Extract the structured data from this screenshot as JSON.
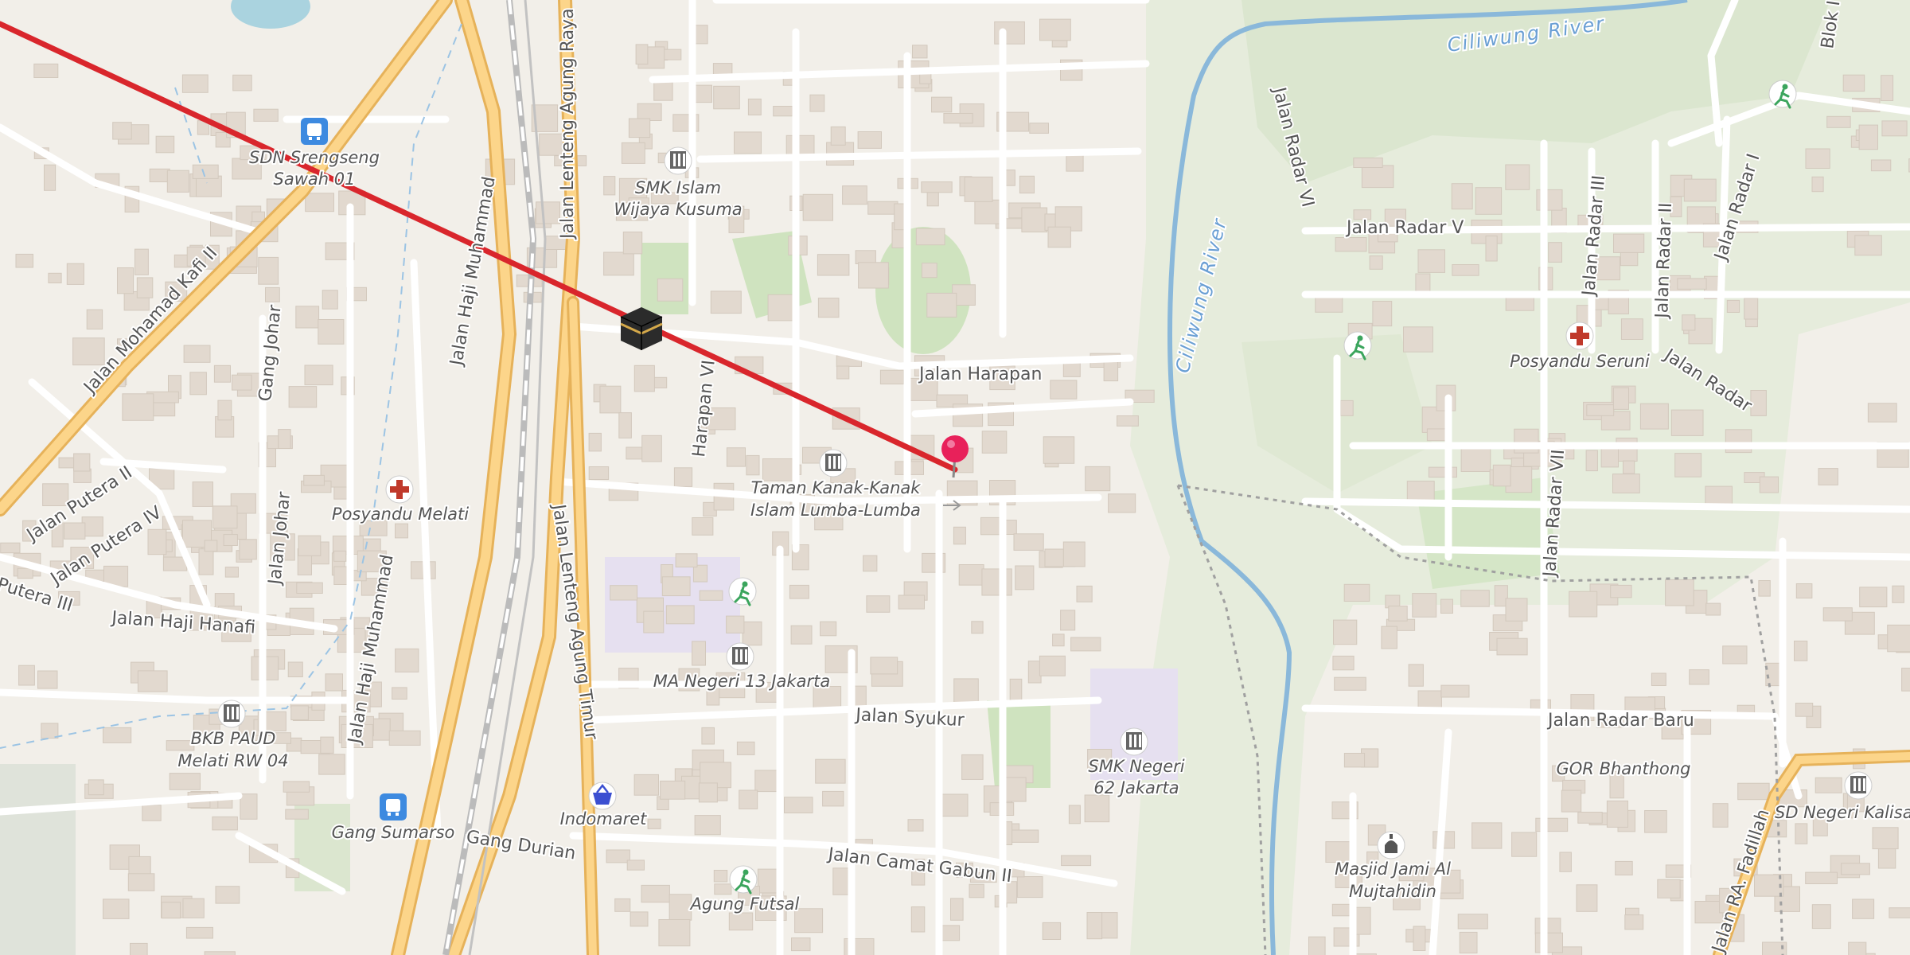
{
  "map": {
    "water_labels": {
      "ciliwung_top": "Ciliwung River",
      "ciliwung_side": "Ciliwung River"
    },
    "roads": {
      "lenteng_agung_raya": "Jalan Lenteng Agung Raya",
      "lenteng_agung_timur": "Jalan Lenteng Agung Timur",
      "haji_muhammad_1": "Jalan Haji Muhammad",
      "haji_muhammad_2": "Jalan Haji Muhammad",
      "mohamad_kafi": "Jalan Mohamad Kafi II",
      "gang_johar": "Gang Johar",
      "jalan_johar": "Jalan Johar",
      "putera_2": "Jalan Putera II",
      "putera_4": "Jalan Putera IV",
      "putera_3": "Putera III",
      "haji_hanafi": "Jalan Haji Hanafi",
      "harapan_vi": "Harapan VI",
      "harapan": "Jalan Harapan",
      "syukur": "Jalan Syukur",
      "camat_gabun": "Jalan Camat Gabun II",
      "gang_durian": "Gang Durian",
      "radar_v": "Jalan Radar V",
      "radar_vi": "Jalan Radar VI",
      "radar_iii": "Jalan Radar III",
      "radar_ii": "Jalan Radar II",
      "radar_i": "Jalan Radar I",
      "radar": "Jalan Radar",
      "radar_vii": "Jalan Radar VII",
      "radar_baru": "Jalan Radar Baru",
      "ra_fadillah": "Jalan RA. Fadillah",
      "blok": "Blok I"
    },
    "pois": [
      {
        "id": "sdn-srengseng",
        "lines": [
          "SDN Srengseng",
          "Sawah 01"
        ],
        "icon": "bus-stop-icon"
      },
      {
        "id": "smk-islam",
        "lines": [
          "SMK Islam",
          "Wijaya Kusuma"
        ],
        "icon": "school-icon"
      },
      {
        "id": "posyandu-melati",
        "lines": [
          "Posyandu Melati"
        ],
        "icon": "health-cross-icon"
      },
      {
        "id": "tk-lumba",
        "lines": [
          "Taman Kanak-Kanak",
          "Islam Lumba-Lumba"
        ],
        "icon": "school-icon"
      },
      {
        "id": "ma-negeri-13",
        "lines": [
          "MA Negeri 13 Jakarta"
        ],
        "icon": "school-icon"
      },
      {
        "id": "bkb-paud",
        "lines": [
          "BKB PAUD",
          "Melati RW 04"
        ],
        "icon": "school-icon"
      },
      {
        "id": "gang-sumarso",
        "lines": [
          "Gang Sumarso"
        ],
        "icon": "bus-stop-icon"
      },
      {
        "id": "indomaret",
        "lines": [
          "Indomaret"
        ],
        "icon": "shopping-basket-icon"
      },
      {
        "id": "agung-futsal",
        "lines": [
          "Agung Futsal"
        ],
        "icon": "sports-icon"
      },
      {
        "id": "smk-negeri-62",
        "lines": [
          "SMK Negeri",
          "62 Jakarta"
        ],
        "icon": "school-icon"
      },
      {
        "id": "posyandu-seruni",
        "lines": [
          "Posyandu Seruni"
        ],
        "icon": "health-cross-icon"
      },
      {
        "id": "gor-bhanthong",
        "lines": [
          "GOR Bhanthong"
        ],
        "icon": ""
      },
      {
        "id": "masjid-jami",
        "lines": [
          "Masjid Jami Al",
          "Mujtahidin"
        ],
        "icon": "mosque-icon"
      },
      {
        "id": "sd-negeri-kalisari",
        "lines": [
          "SD Negeri Kalisari"
        ],
        "icon": "school-icon"
      }
    ],
    "route_color": "#d9262c",
    "pin_color": "#e8215a"
  }
}
